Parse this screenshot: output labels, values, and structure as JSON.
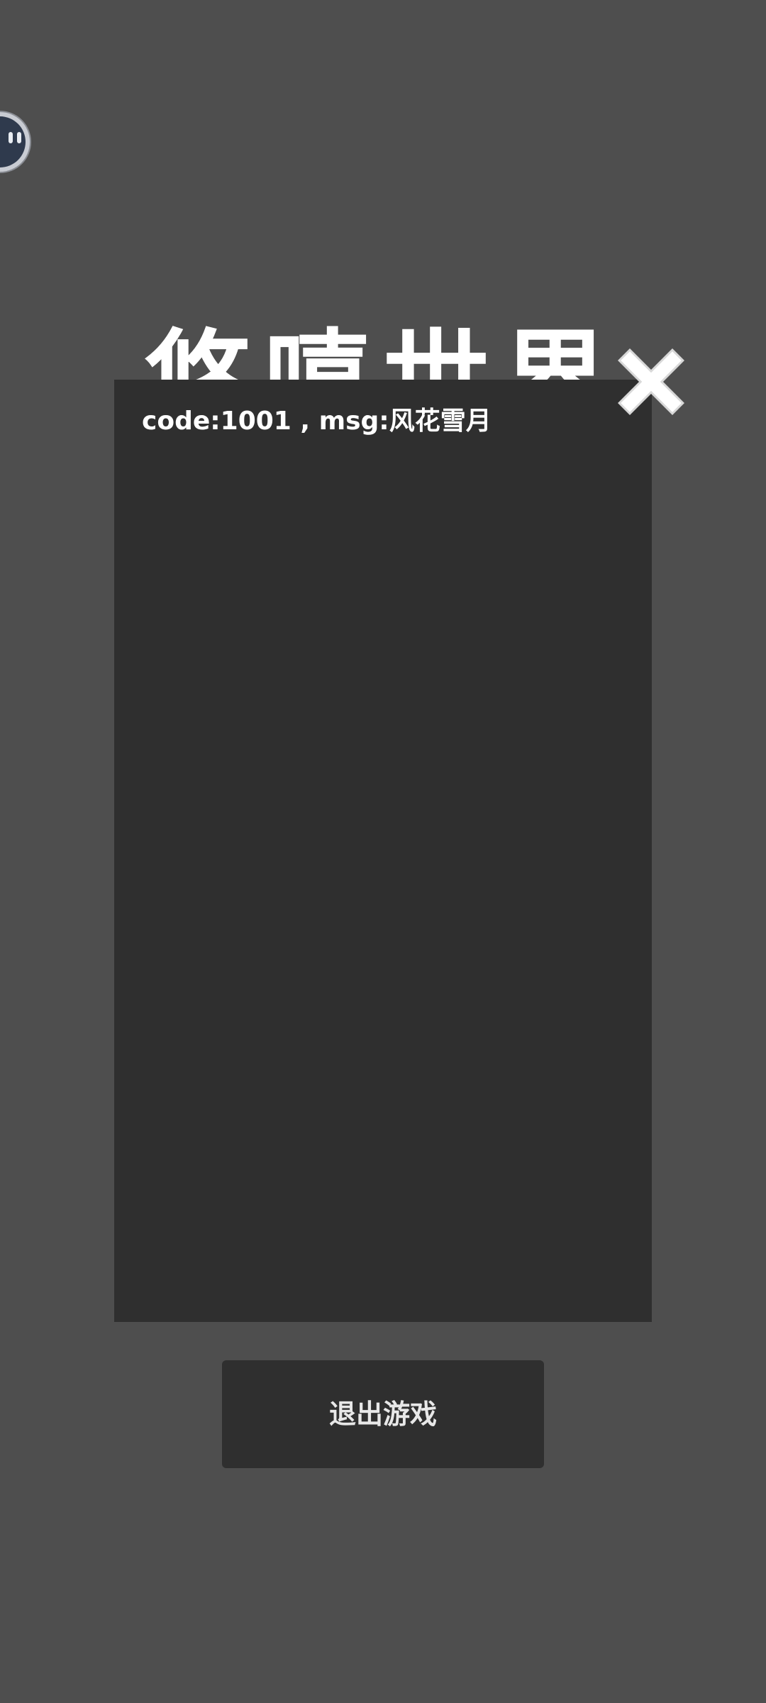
{
  "background": {
    "title": "悠嘻世界"
  },
  "dialog": {
    "message": "code:1001 , msg:风花雪月",
    "close_icon": "close-icon"
  },
  "actions": {
    "exit_label": "退出游戏"
  },
  "floating_ball": {
    "icon": "assistant-ball-icon"
  },
  "colors": {
    "background": "#4e4e4e",
    "panel": "#2f2f2f",
    "text": "#ffffff"
  }
}
